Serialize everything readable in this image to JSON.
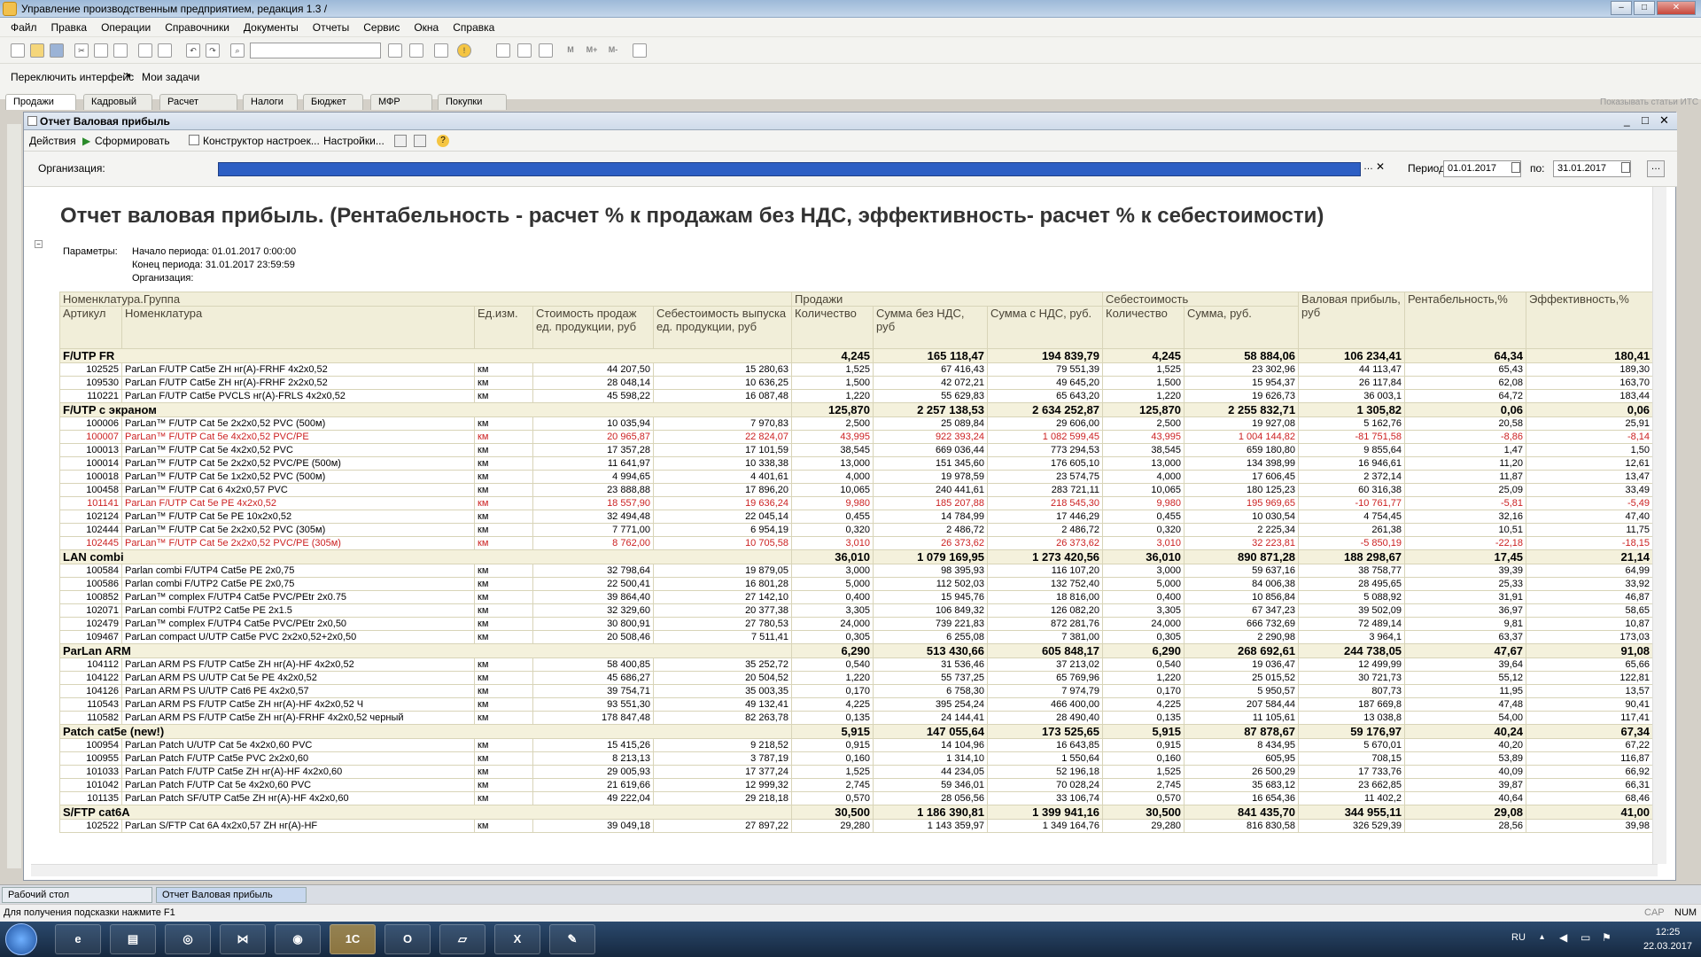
{
  "window": {
    "title": "Управление производственным предприятием, редакция 1.3 /"
  },
  "menu": [
    "Файл",
    "Правка",
    "Операции",
    "Справочники",
    "Документы",
    "Отчеты",
    "Сервис",
    "Окна",
    "Справка"
  ],
  "panel": {
    "switch_interface": "Переключить интерфейс",
    "my_tasks": "Мои задачи",
    "show_its": "Показывать статьи ИТС"
  },
  "tabs": [
    "Продажи",
    "Кадровый",
    "Расчет",
    "Налоги",
    "Бюджет",
    "МФР",
    "Покупки"
  ],
  "doc": {
    "title": "Отчет  Валовая прибыль",
    "actions": {
      "actions": "Действия",
      "generate": "Сформировать",
      "constructor": "Конструктор настроек...",
      "settings": "Настройки..."
    },
    "org_label": "Организация:",
    "period_label": "Период с:",
    "date_from": "01.01.2017",
    "to_label": "по:",
    "date_to": "31.01.2017"
  },
  "report": {
    "title": "Отчет валовая прибыль. (Рентабельность - расчет % к продажам без НДС, эффективность- расчет % к себестоимости)",
    "params_label": "Параметры:",
    "param_start": "Начало периода: 01.01.2017 0:00:00",
    "param_end": "Конец периода: 31.01.2017 23:59:59",
    "param_org": "Организация:",
    "headers": {
      "group": "Номенклатура.Группа",
      "sales": "Продажи",
      "cost": "Себестоимость",
      "gross": "Валовая прибыль, руб",
      "rent": "Рентабельность,%",
      "eff": "Эффективность,%",
      "article": "Артикул",
      "nom": "Номенклатура",
      "unit": "Ед.изм.",
      "unit_price": "Стоимость продаж ед. продукции, руб",
      "unit_cost": "Себестоимость выпуска ед. продукции, руб",
      "qty": "Количество",
      "sum_no_vat": "Сумма без НДС, руб",
      "sum_vat": "Сумма с НДС, руб.",
      "cost_qty": "Количество",
      "cost_sum": "Сумма, руб."
    },
    "rows": [
      {
        "type": "group",
        "name": "F/UTP FR",
        "v": [
          "4,245",
          "165 118,47",
          "194 839,79",
          "4,245",
          "58 884,06",
          "106 234,41",
          "64,34",
          "180,41"
        ]
      },
      {
        "art": "102525",
        "nom": "ParLan F/UTP Cat5e ZH нг(А)-FRHF 4x2x0,52",
        "unit": "км",
        "p": "44 207,50",
        "c": "15 280,63",
        "v": [
          "1,525",
          "67 416,43",
          "79 551,39",
          "1,525",
          "23 302,96",
          "44 113,47",
          "65,43",
          "189,30"
        ]
      },
      {
        "art": "109530",
        "nom": "ParLan F/UTP Cat5e ZH нг(А)-FRHF 2x2x0,52",
        "unit": "км",
        "p": "28 048,14",
        "c": "10 636,25",
        "v": [
          "1,500",
          "42 072,21",
          "49 645,20",
          "1,500",
          "15 954,37",
          "26 117,84",
          "62,08",
          "163,70"
        ]
      },
      {
        "art": "110221",
        "nom": "ParLan F/UTP Cat5e PVCLS нг(А)-FRLS 4x2x0,52",
        "unit": "км",
        "p": "45 598,22",
        "c": "16 087,48",
        "v": [
          "1,220",
          "55 629,83",
          "65 643,20",
          "1,220",
          "19 626,73",
          "36 003,1",
          "64,72",
          "183,44"
        ]
      },
      {
        "type": "group",
        "name": "F/UTP с экраном",
        "v": [
          "125,870",
          "2 257 138,53",
          "2 634 252,87",
          "125,870",
          "2 255 832,71",
          "1 305,82",
          "0,06",
          "0,06"
        ]
      },
      {
        "art": "100006",
        "nom": "ParLan™ F/UTP Cat 5e 2x2x0,52 PVC (500м)",
        "unit": "км",
        "p": "10 035,94",
        "c": "7 970,83",
        "v": [
          "2,500",
          "25 089,84",
          "29 606,00",
          "2,500",
          "19 927,08",
          "5 162,76",
          "20,58",
          "25,91"
        ]
      },
      {
        "red": true,
        "art": "100007",
        "nom": "ParLan™ F/UTP Cat 5e 4x2x0,52 PVC/PE",
        "unit": "км",
        "p": "20 965,87",
        "c": "22 824,07",
        "v": [
          "43,995",
          "922 393,24",
          "1 082 599,45",
          "43,995",
          "1 004 144,82",
          "-81 751,58",
          "-8,86",
          "-8,14"
        ]
      },
      {
        "art": "100013",
        "nom": "ParLan™ F/UTP Cat 5e 4x2x0,52 PVC",
        "unit": "км",
        "p": "17 357,28",
        "c": "17 101,59",
        "v": [
          "38,545",
          "669 036,44",
          "773 294,53",
          "38,545",
          "659 180,80",
          "9 855,64",
          "1,47",
          "1,50"
        ]
      },
      {
        "art": "100014",
        "nom": "ParLan™ F/UTP Cat 5e 2x2x0,52 PVC/PE (500м)",
        "unit": "км",
        "p": "11 641,97",
        "c": "10 338,38",
        "v": [
          "13,000",
          "151 345,60",
          "176 605,10",
          "13,000",
          "134 398,99",
          "16 946,61",
          "11,20",
          "12,61"
        ]
      },
      {
        "art": "100018",
        "nom": "ParLan™ F/UTP Cat 5e 1x2x0,52 PVC (500м)",
        "unit": "км",
        "p": "4 994,65",
        "c": "4 401,61",
        "v": [
          "4,000",
          "19 978,59",
          "23 574,75",
          "4,000",
          "17 606,45",
          "2 372,14",
          "11,87",
          "13,47"
        ]
      },
      {
        "art": "100458",
        "nom": "ParLan™ F/UTP Cat 6 4x2x0,57 PVC",
        "unit": "км",
        "p": "23 888,88",
        "c": "17 896,20",
        "v": [
          "10,065",
          "240 441,61",
          "283 721,11",
          "10,065",
          "180 125,23",
          "60 316,38",
          "25,09",
          "33,49"
        ]
      },
      {
        "red": true,
        "art": "101141",
        "nom": "ParLan F/UTP Cat 5e PE 4x2x0,52",
        "unit": "км",
        "p": "18 557,90",
        "c": "19 636,24",
        "v": [
          "9,980",
          "185 207,88",
          "218 545,30",
          "9,980",
          "195 969,65",
          "-10 761,77",
          "-5,81",
          "-5,49"
        ]
      },
      {
        "art": "102124",
        "nom": "ParLan™ F/UTP Cat 5e PE 10x2x0,52",
        "unit": "км",
        "p": "32 494,48",
        "c": "22 045,14",
        "v": [
          "0,455",
          "14 784,99",
          "17 446,29",
          "0,455",
          "10 030,54",
          "4 754,45",
          "32,16",
          "47,40"
        ]
      },
      {
        "art": "102444",
        "nom": "ParLan™ F/UTP Cat 5e 2x2x0,52 PVC (305м)",
        "unit": "км",
        "p": "7 771,00",
        "c": "6 954,19",
        "v": [
          "0,320",
          "2 486,72",
          "2 486,72",
          "0,320",
          "2 225,34",
          "261,38",
          "10,51",
          "11,75"
        ]
      },
      {
        "red": true,
        "art": "102445",
        "nom": "ParLan™ F/UTP Cat 5e 2x2x0,52 PVC/PE (305м)",
        "unit": "км",
        "p": "8 762,00",
        "c": "10 705,58",
        "v": [
          "3,010",
          "26 373,62",
          "26 373,62",
          "3,010",
          "32 223,81",
          "-5 850,19",
          "-22,18",
          "-18,15"
        ]
      },
      {
        "type": "group",
        "name": "LAN combi",
        "v": [
          "36,010",
          "1 079 169,95",
          "1 273 420,56",
          "36,010",
          "890 871,28",
          "188 298,67",
          "17,45",
          "21,14"
        ]
      },
      {
        "art": "100584",
        "nom": "Parlan combi F/UTP4 Cat5e PE 2x0,75",
        "unit": "км",
        "p": "32 798,64",
        "c": "19 879,05",
        "v": [
          "3,000",
          "98 395,93",
          "116 107,20",
          "3,000",
          "59 637,16",
          "38 758,77",
          "39,39",
          "64,99"
        ]
      },
      {
        "art": "100586",
        "nom": "Parlan combi F/UTP2 Cat5e PE 2x0,75",
        "unit": "км",
        "p": "22 500,41",
        "c": "16 801,28",
        "v": [
          "5,000",
          "112 502,03",
          "132 752,40",
          "5,000",
          "84 006,38",
          "28 495,65",
          "25,33",
          "33,92"
        ]
      },
      {
        "art": "100852",
        "nom": "ParLan™ complex F/UTP4 Cat5e PVC/PEtr 2x0.75",
        "unit": "км",
        "p": "39 864,40",
        "c": "27 142,10",
        "v": [
          "0,400",
          "15 945,76",
          "18 816,00",
          "0,400",
          "10 856,84",
          "5 088,92",
          "31,91",
          "46,87"
        ]
      },
      {
        "art": "102071",
        "nom": "ParLan combi F/UTP2 Cat5e PE 2x1.5",
        "unit": "км",
        "p": "32 329,60",
        "c": "20 377,38",
        "v": [
          "3,305",
          "106 849,32",
          "126 082,20",
          "3,305",
          "67 347,23",
          "39 502,09",
          "36,97",
          "58,65"
        ]
      },
      {
        "art": "102479",
        "nom": "ParLan™ complex F/UTP4 Cat5e PVC/PEtr 2x0,50",
        "unit": "км",
        "p": "30 800,91",
        "c": "27 780,53",
        "v": [
          "24,000",
          "739 221,83",
          "872 281,76",
          "24,000",
          "666 732,69",
          "72 489,14",
          "9,81",
          "10,87"
        ]
      },
      {
        "art": "109467",
        "nom": "ParLan compact U/UTP Cat5e PVC 2x2x0,52+2x0,50",
        "unit": "км",
        "p": "20 508,46",
        "c": "7 511,41",
        "v": [
          "0,305",
          "6 255,08",
          "7 381,00",
          "0,305",
          "2 290,98",
          "3 964,1",
          "63,37",
          "173,03"
        ]
      },
      {
        "type": "group",
        "name": "ParLan ARM",
        "v": [
          "6,290",
          "513 430,66",
          "605 848,17",
          "6,290",
          "268 692,61",
          "244 738,05",
          "47,67",
          "91,08"
        ]
      },
      {
        "art": "104112",
        "nom": "ParLan ARM PS F/UTP Cat5e ZH нг(А)-HF 4x2x0,52",
        "unit": "км",
        "p": "58 400,85",
        "c": "35 252,72",
        "v": [
          "0,540",
          "31 536,46",
          "37 213,02",
          "0,540",
          "19 036,47",
          "12 499,99",
          "39,64",
          "65,66"
        ]
      },
      {
        "art": "104122",
        "nom": "ParLan ARM PS U/UTP Cat 5e PE 4x2x0,52",
        "unit": "км",
        "p": "45 686,27",
        "c": "20 504,52",
        "v": [
          "1,220",
          "55 737,25",
          "65 769,96",
          "1,220",
          "25 015,52",
          "30 721,73",
          "55,12",
          "122,81"
        ]
      },
      {
        "art": "104126",
        "nom": "ParLan ARM PS U/UTP Cat6 PE 4x2x0,57",
        "unit": "км",
        "p": "39 754,71",
        "c": "35 003,35",
        "v": [
          "0,170",
          "6 758,30",
          "7 974,79",
          "0,170",
          "5 950,57",
          "807,73",
          "11,95",
          "13,57"
        ]
      },
      {
        "art": "110543",
        "nom": "ParLan ARM PS F/UTP Cat5e ZH нг(А)-HF 4x2x0,52 Ч",
        "unit": "км",
        "p": "93 551,30",
        "c": "49 132,41",
        "v": [
          "4,225",
          "395 254,24",
          "466 400,00",
          "4,225",
          "207 584,44",
          "187 669,8",
          "47,48",
          "90,41"
        ]
      },
      {
        "art": "110582",
        "nom": "ParLan ARM PS F/UTP Cat5e ZH нг(А)-FRHF 4x2x0,52 черный",
        "unit": "км",
        "p": "178 847,48",
        "c": "82 263,78",
        "v": [
          "0,135",
          "24 144,41",
          "28 490,40",
          "0,135",
          "11 105,61",
          "13 038,8",
          "54,00",
          "117,41"
        ]
      },
      {
        "type": "group",
        "name": "Patch cat5e (new!)",
        "v": [
          "5,915",
          "147 055,64",
          "173 525,65",
          "5,915",
          "87 878,67",
          "59 176,97",
          "40,24",
          "67,34"
        ]
      },
      {
        "art": "100954",
        "nom": "ParLan Patch  U/UTP Cat 5e 4x2x0,60 PVC",
        "unit": "км",
        "p": "15 415,26",
        "c": "9 218,52",
        "v": [
          "0,915",
          "14 104,96",
          "16 643,85",
          "0,915",
          "8 434,95",
          "5 670,01",
          "40,20",
          "67,22"
        ]
      },
      {
        "art": "100955",
        "nom": "ParLan Patch  F/UTP Cat5e PVC 2x2x0,60",
        "unit": "км",
        "p": "8 213,13",
        "c": "3 787,19",
        "v": [
          "0,160",
          "1 314,10",
          "1 550,64",
          "0,160",
          "605,95",
          "708,15",
          "53,89",
          "116,87"
        ]
      },
      {
        "art": "101033",
        "nom": "ParLan Patch F/UTP Cat5e ZH нг(А)-HF 4x2x0,60",
        "unit": "км",
        "p": "29 005,93",
        "c": "17 377,24",
        "v": [
          "1,525",
          "44 234,05",
          "52 196,18",
          "1,525",
          "26 500,29",
          "17 733,76",
          "40,09",
          "66,92"
        ]
      },
      {
        "art": "101042",
        "nom": "ParLan Patch F/UTP Cat 5e 4x2x0,60 PVC",
        "unit": "км",
        "p": "21 619,66",
        "c": "12 999,32",
        "v": [
          "2,745",
          "59 346,01",
          "70 028,24",
          "2,745",
          "35 683,12",
          "23 662,85",
          "39,87",
          "66,31"
        ]
      },
      {
        "art": "101135",
        "nom": "ParLan Patch SF/UTP Cat5e ZH нг(А)-HF 4x2x0,60",
        "unit": "км",
        "p": "49 222,04",
        "c": "29 218,18",
        "v": [
          "0,570",
          "28 056,56",
          "33 106,74",
          "0,570",
          "16 654,36",
          "11 402,2",
          "40,64",
          "68,46"
        ]
      },
      {
        "type": "group",
        "name": "S/FTP cat6A",
        "v": [
          "30,500",
          "1 186 390,81",
          "1 399 941,16",
          "30,500",
          "841 435,70",
          "344 955,11",
          "29,08",
          "41,00"
        ]
      },
      {
        "art": "102522",
        "nom": "ParLan S/FTP Cat 6A 4x2x0,57 ZH нг(А)-HF",
        "unit": "км",
        "p": "39 049,18",
        "c": "27 897,22",
        "v": [
          "29,280",
          "1 143 359,97",
          "1 349 164,76",
          "29,280",
          "816 830,58",
          "326 529,39",
          "28,56",
          "39,98"
        ]
      }
    ]
  },
  "windows_bar": {
    "desktop": "Рабочий стол",
    "report": "Отчет  Валовая прибыль"
  },
  "status": {
    "hint": "Для получения подсказки нажмите F1",
    "cap": "CAP",
    "num": "NUM"
  },
  "taskbar": {
    "lang": "RU",
    "time": "12:25",
    "date": "22.03.2017"
  }
}
